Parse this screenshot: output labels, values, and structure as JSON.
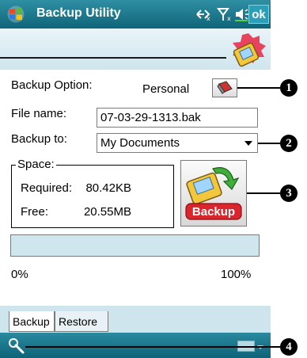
{
  "titlebar": {
    "title": "Backup Utility",
    "ok_label": "ok",
    "start_icon": "windows-flag-icon",
    "status_icons": [
      "connectivity-icon",
      "signal-icon",
      "volume-icon"
    ]
  },
  "form": {
    "backup_option_label": "Backup Option:",
    "backup_option_value": "Personal",
    "file_name_label": "File name:",
    "file_name_value": "07-03-29-1313.bak",
    "backup_to_label": "Backup to:",
    "backup_to_value": "My Documents"
  },
  "space": {
    "title": "Space:",
    "required_label": "Required:",
    "required_value": "80.42KB",
    "free_label": "Free:",
    "free_value": "20.55MB"
  },
  "backup_button_label": "Backup",
  "progress": {
    "value": 0,
    "start_label": "0%",
    "end_label": "100%"
  },
  "tabs": [
    {
      "label": "Backup",
      "active": true
    },
    {
      "label": "Restore",
      "active": false
    }
  ],
  "callouts": [
    "1",
    "2",
    "3",
    "4"
  ],
  "colors": {
    "titlebar": "#0f6478",
    "accent": "#2a9fb7",
    "progress_bg": "#cfe6ef"
  }
}
